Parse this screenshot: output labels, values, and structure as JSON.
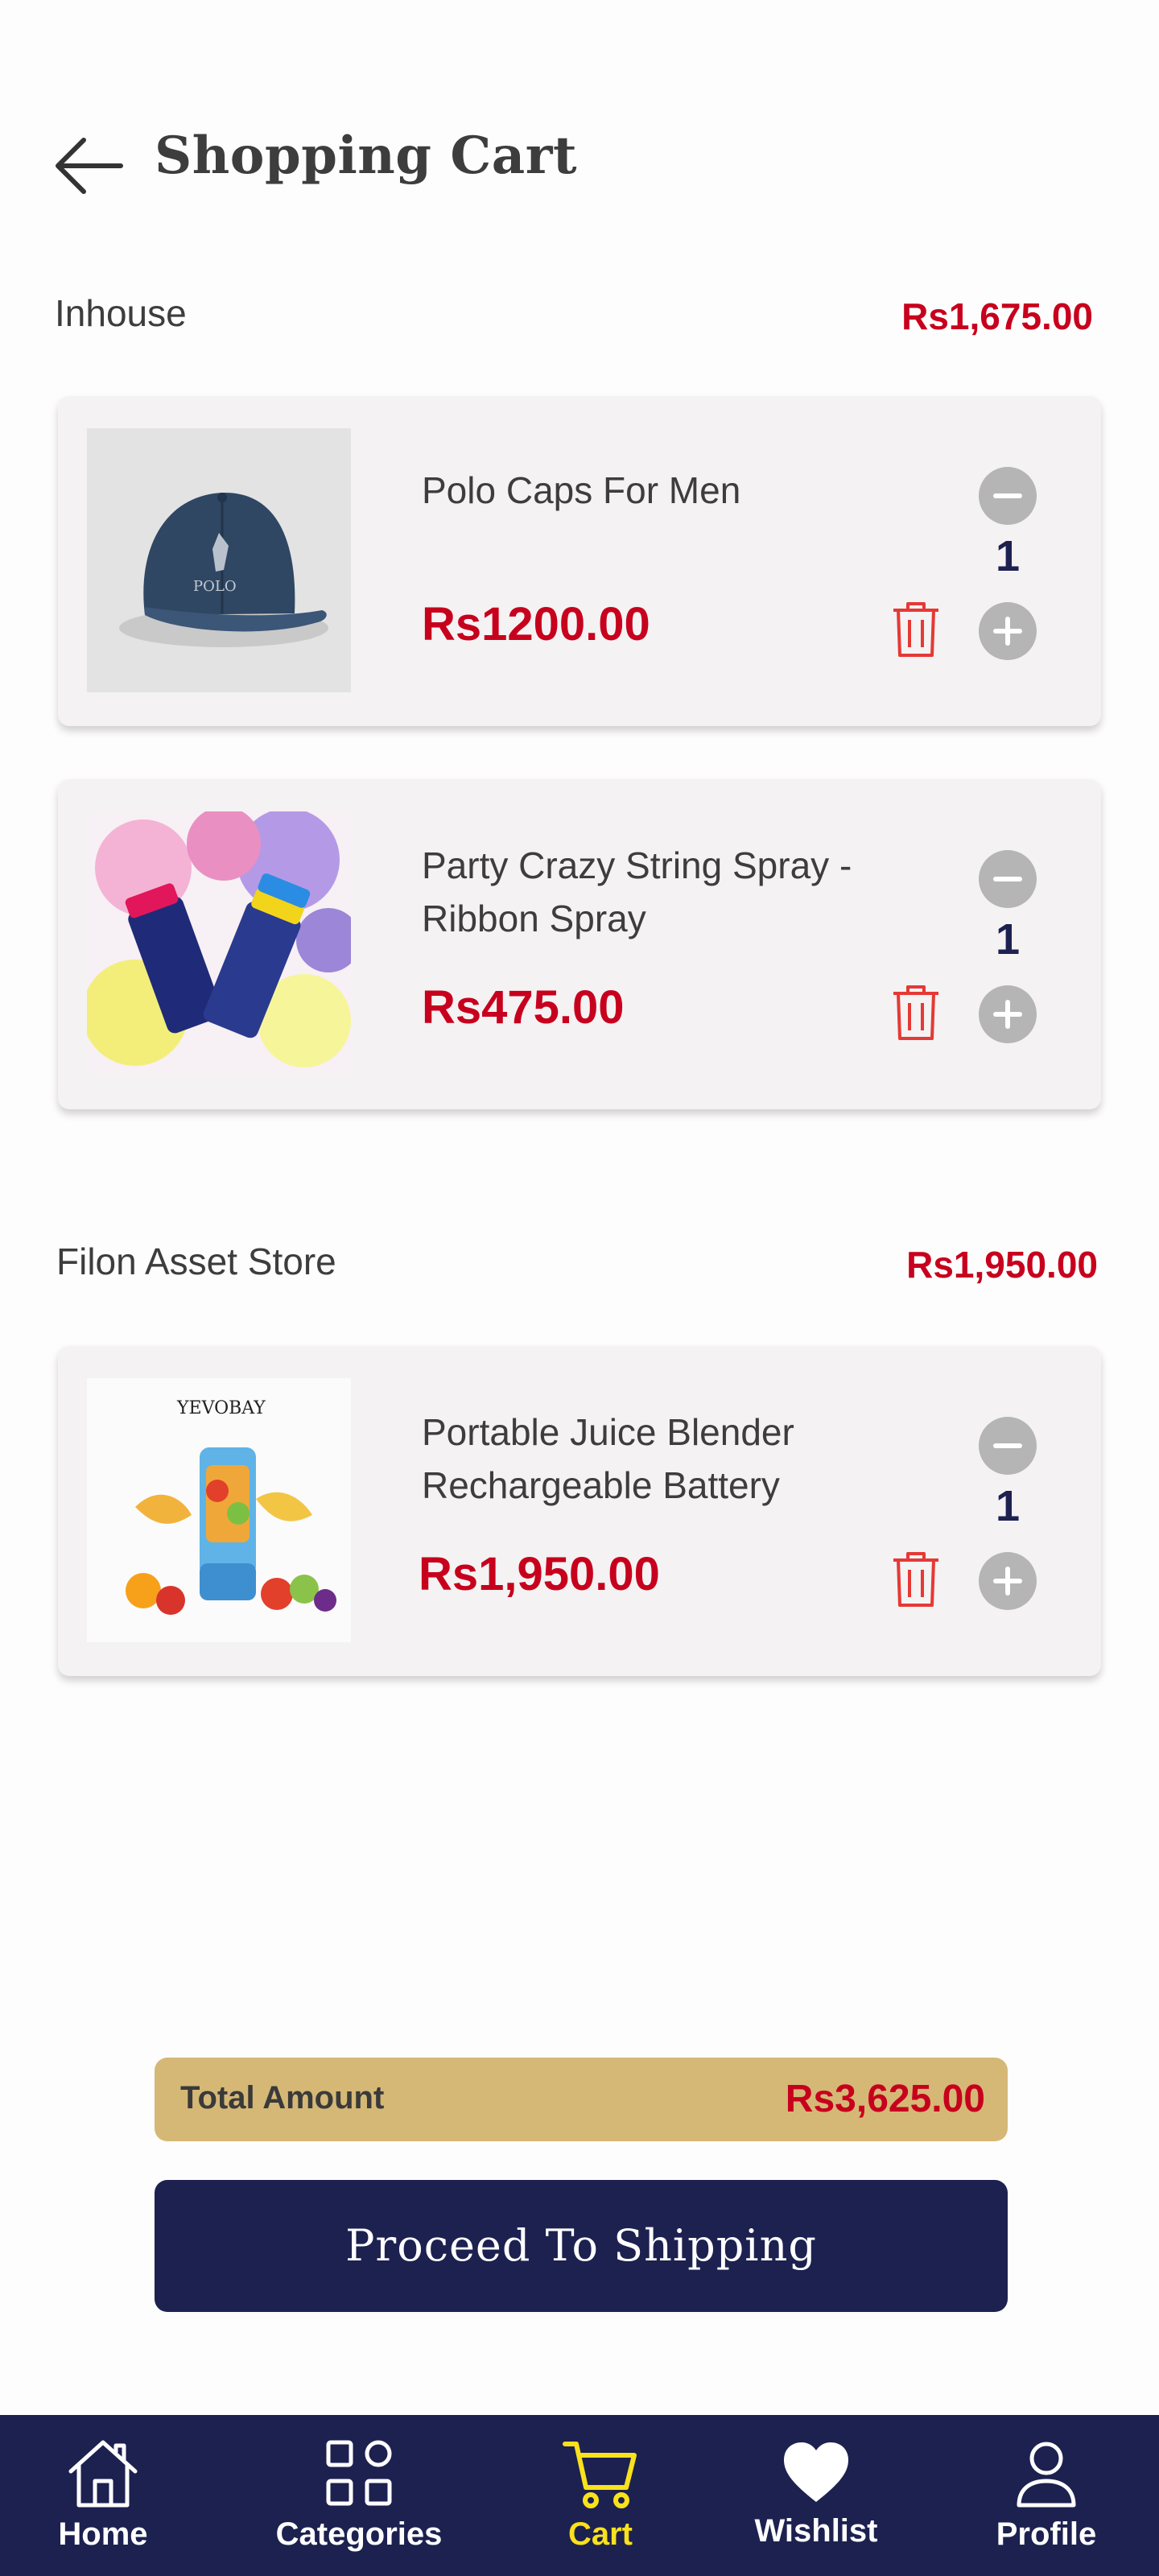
{
  "header": {
    "title": "Shopping Cart"
  },
  "stores": [
    {
      "name": "Inhouse",
      "total": "Rs1,675.00",
      "items": [
        {
          "name": "Polo Caps For  Men",
          "price": "Rs1200.00",
          "qty": "1",
          "image": "cap"
        },
        {
          "name": "Party Crazy String Spray - Ribbon Spray",
          "price": "Rs475.00",
          "qty": "1",
          "image": "spray"
        }
      ]
    },
    {
      "name": "Filon Asset Store",
      "total": "Rs1,950.00",
      "items": [
        {
          "name": "Portable Juice Blender Rechargeable Battery",
          "price": "Rs1,950.00",
          "qty": "1",
          "image": "blender",
          "brand": "YEVOBAY"
        }
      ]
    }
  ],
  "summary": {
    "label": "Total Amount",
    "value": "Rs3,625.00"
  },
  "proceed_label": "Proceed To Shipping",
  "nav": [
    {
      "label": "Home",
      "icon": "home-icon"
    },
    {
      "label": "Categories",
      "icon": "grid-icon"
    },
    {
      "label": "Cart",
      "icon": "cart-icon",
      "active": true
    },
    {
      "label": "Wishlist",
      "icon": "heart-icon"
    },
    {
      "label": "Profile",
      "icon": "user-icon"
    }
  ],
  "colors": {
    "navy": "#1c2150",
    "price_red": "#c7001d",
    "gold": "#d5b876",
    "active_yellow": "#f9e11c"
  }
}
